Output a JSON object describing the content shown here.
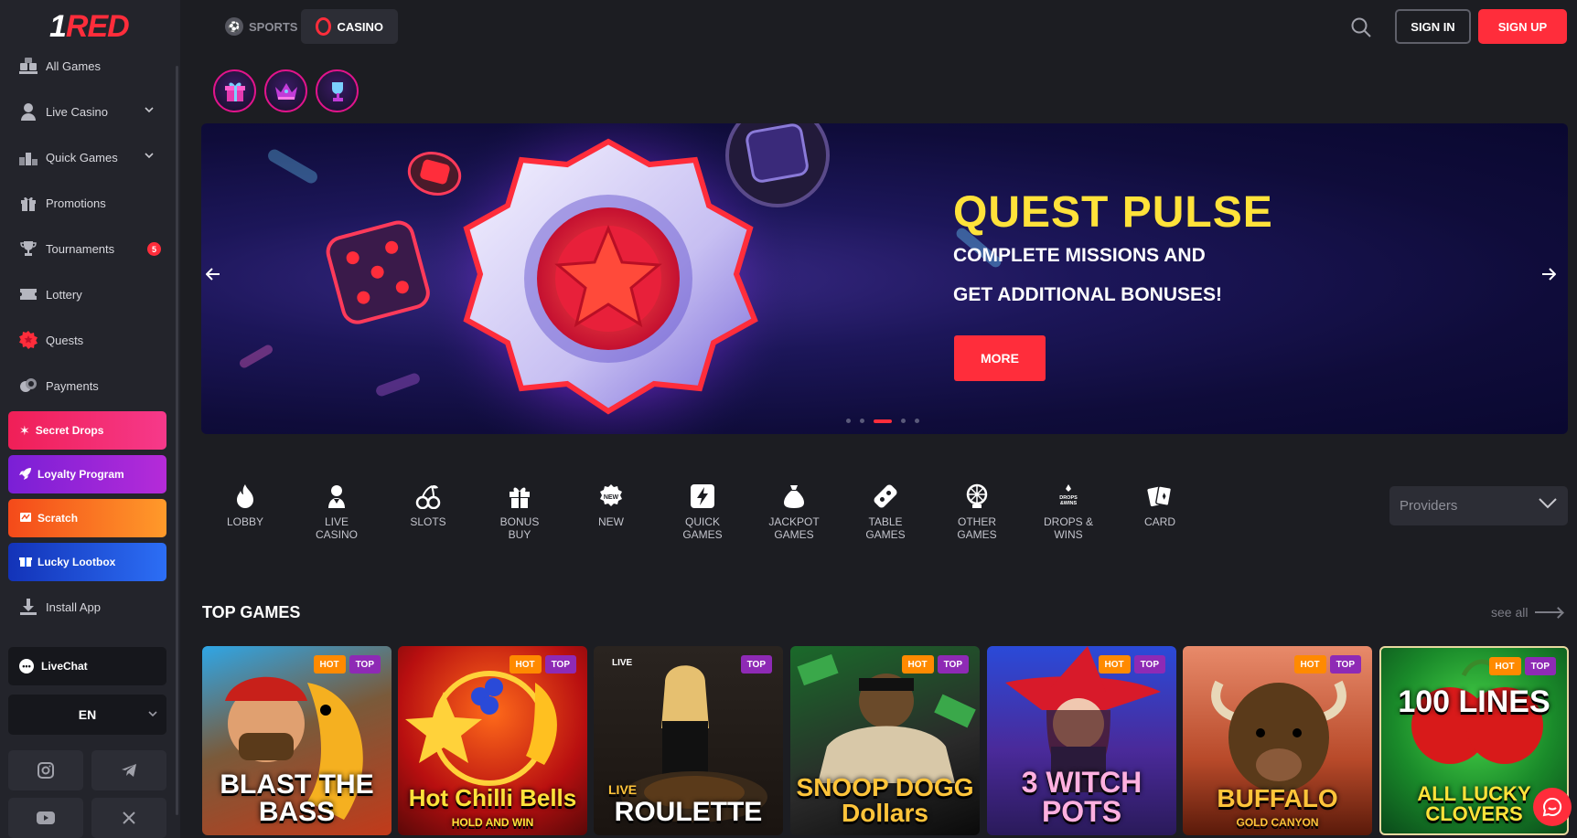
{
  "brand": {
    "logo_prefix": "1",
    "logo_text": "RED"
  },
  "colors": {
    "accent": "#ff2d3b",
    "sidebar_bg": "#23242b",
    "page_bg": "#1c1d22",
    "banner_title": "#ffe23a",
    "tag_hot": "#ff8a00",
    "tag_top": "#8e2ab5"
  },
  "sidebar": {
    "items": [
      {
        "label": "All Games",
        "icon": "dice-icon"
      },
      {
        "label": "Live Casino",
        "icon": "dealer-icon",
        "expandable": true
      },
      {
        "label": "Quick Games",
        "icon": "podium-icon",
        "expandable": true
      },
      {
        "label": "Promotions",
        "icon": "gift-icon"
      },
      {
        "label": "Tournaments",
        "icon": "trophy-icon",
        "badge": "5"
      },
      {
        "label": "Lottery",
        "icon": "ticket-icon"
      },
      {
        "label": "Quests",
        "icon": "quest-icon"
      },
      {
        "label": "Payments",
        "icon": "coins-icon"
      }
    ],
    "promos": [
      {
        "label": "Secret Drops",
        "icon": "confetti-icon"
      },
      {
        "label": "Loyalty Program",
        "icon": "rocket-icon"
      },
      {
        "label": "Scratch",
        "icon": "scratch-icon"
      },
      {
        "label": "Lucky Lootbox",
        "icon": "lootbox-icon"
      }
    ],
    "install": {
      "label": "Install App",
      "icon": "download-icon"
    },
    "livechat": "LiveChat",
    "language": "EN",
    "social": [
      "instagram-icon",
      "telegram-icon",
      "youtube-icon",
      "x-icon"
    ]
  },
  "header": {
    "tabs": [
      {
        "label": "SPORTS",
        "active": false
      },
      {
        "label": "CASINO",
        "active": true
      }
    ],
    "sign_in": "SIGN IN",
    "sign_up": "SIGN UP"
  },
  "banner": {
    "title": "QUEST PULSE",
    "subtitle_line1": "COMPLETE MISSIONS AND",
    "subtitle_line2": "GET ADDITIONAL BONUSES!",
    "cta": "MORE",
    "slides": 5,
    "active_slide": 3
  },
  "categories": [
    {
      "label": "LOBBY",
      "icon": "flame-icon"
    },
    {
      "label": "LIVE\nCASINO",
      "icon": "dealer-icon"
    },
    {
      "label": "SLOTS",
      "icon": "cherries-icon"
    },
    {
      "label": "BONUS\nBUY",
      "icon": "gift-icon"
    },
    {
      "label": "NEW",
      "icon": "new-badge-icon"
    },
    {
      "label": "QUICK\nGAMES",
      "icon": "lightning-icon"
    },
    {
      "label": "JACKPOT\nGAMES",
      "icon": "money-bag-icon"
    },
    {
      "label": "TABLE\nGAMES",
      "icon": "chip-icon"
    },
    {
      "label": "OTHER\nGAMES",
      "icon": "wheel-icon"
    },
    {
      "label": "DROPS &\nWINS",
      "icon": "drops-wins-icon"
    },
    {
      "label": "CARD",
      "icon": "cards-icon"
    }
  ],
  "providers": {
    "label": "Providers"
  },
  "top_games": {
    "title": "TOP GAMES",
    "see_all": "see all",
    "games": [
      {
        "title": "BLAST THE BASS",
        "tags": [
          "HOT",
          "TOP"
        ],
        "live": false
      },
      {
        "title": "Hot Chilli Bells",
        "subtitle": "HOLD AND WIN",
        "tags": [
          "HOT",
          "TOP"
        ],
        "live": false
      },
      {
        "title": "ROULETTE",
        "prefix": "LIVE",
        "tags": [
          "TOP"
        ],
        "live": true,
        "live_label": "LIVE"
      },
      {
        "title": "SNOOP DOGG Dollars",
        "tags": [
          "HOT",
          "TOP"
        ],
        "live": false
      },
      {
        "title": "3 WITCH POTS",
        "tags": [
          "HOT",
          "TOP"
        ],
        "live": false
      },
      {
        "title": "BUFFALO",
        "subtitle": "GOLD CANYON",
        "tags": [
          "HOT",
          "TOP"
        ],
        "live": false
      },
      {
        "title": "100 LINES",
        "subtitle": "ALL LUCKY CLOVERS",
        "tags": [
          "HOT",
          "TOP"
        ],
        "live": false
      }
    ]
  }
}
